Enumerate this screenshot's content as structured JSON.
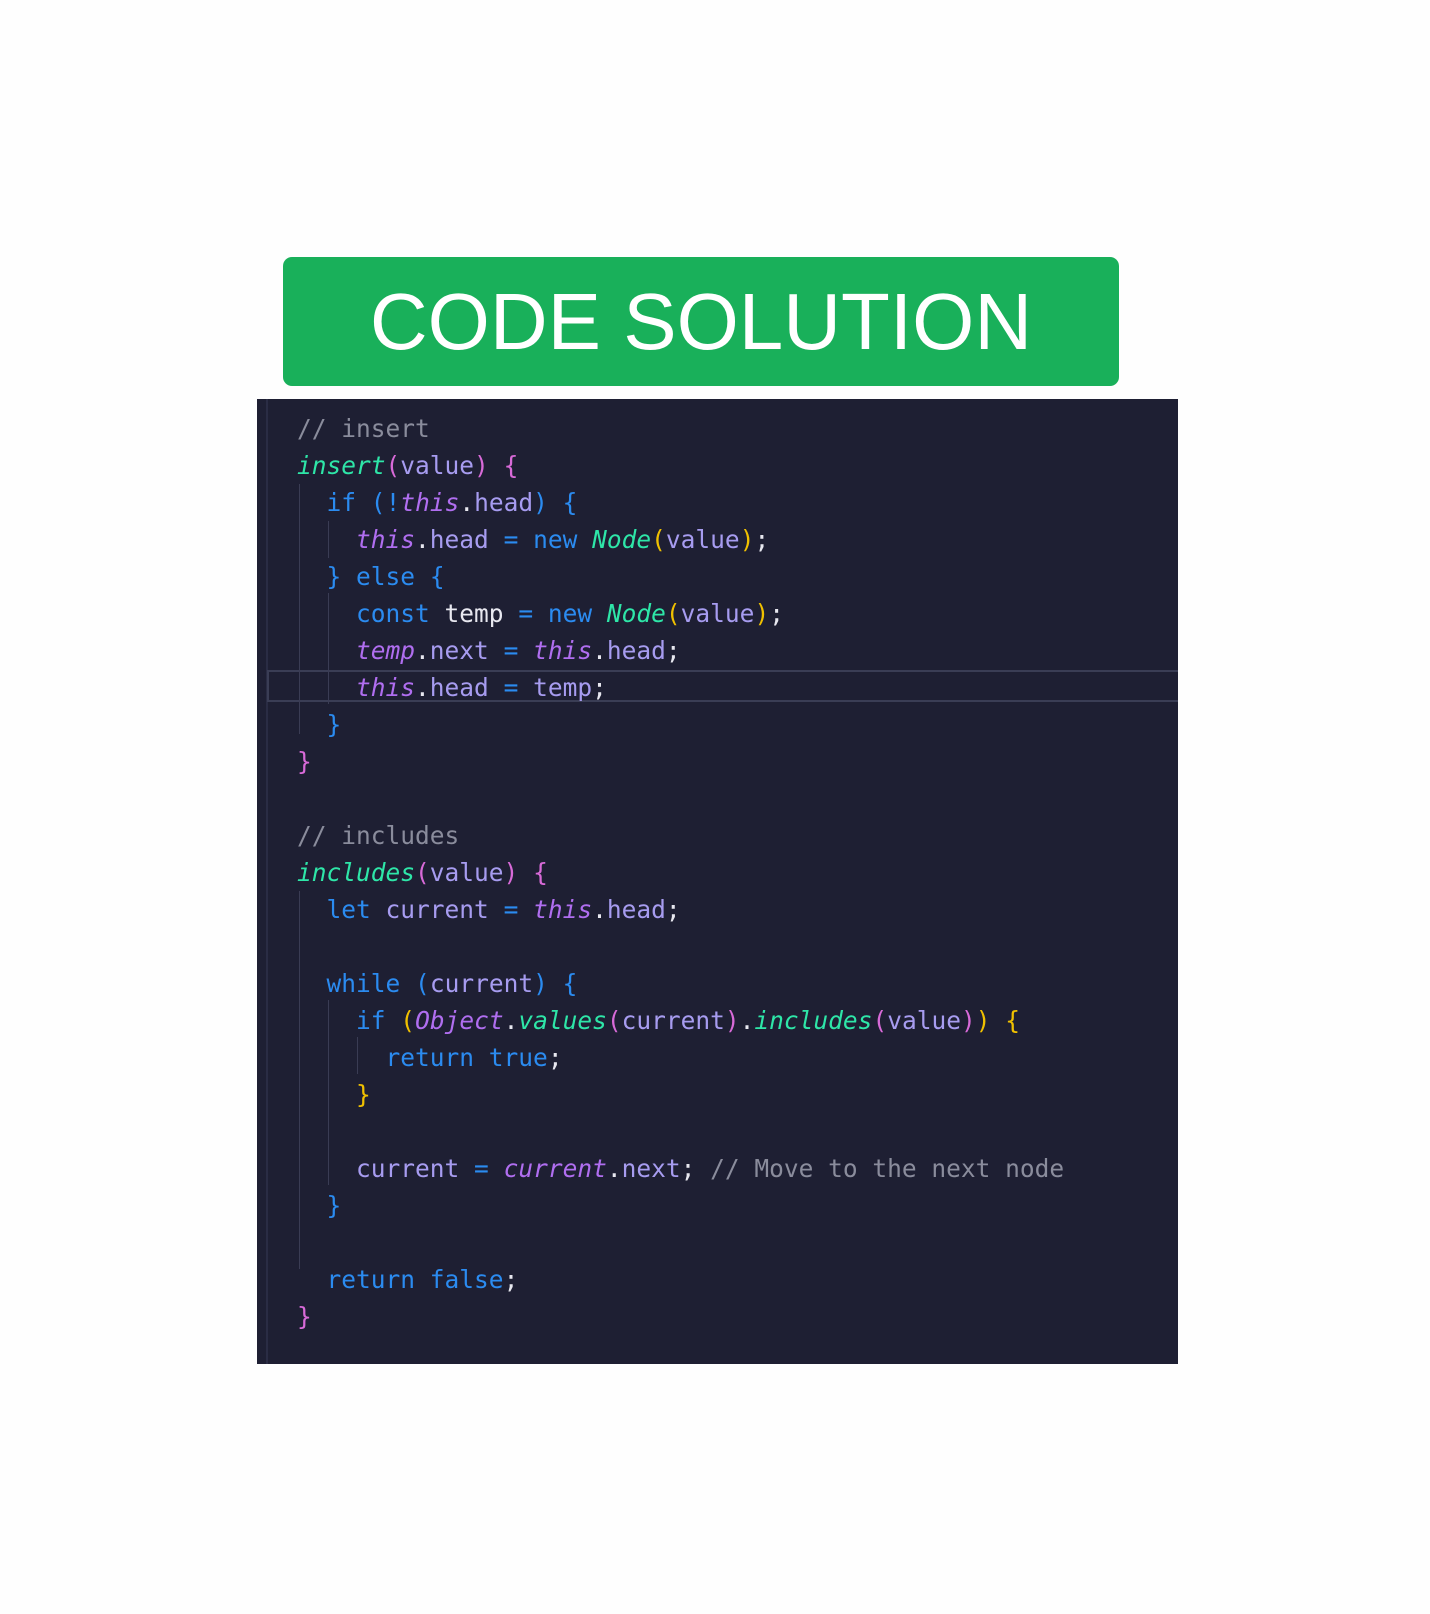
{
  "banner": {
    "title": "CODE SOLUTION",
    "color": "#19b05a"
  },
  "editor": {
    "background": "#1e1f33",
    "lines": [
      [
        {
          "t": "// insert",
          "c": "t-comment"
        }
      ],
      [
        {
          "t": "insert",
          "c": "t-fn"
        },
        {
          "t": "(",
          "c": "t-paren"
        },
        {
          "t": "value",
          "c": "t-param"
        },
        {
          "t": ")",
          "c": "t-paren"
        },
        {
          "t": " ",
          "c": "t-punct"
        },
        {
          "t": "{",
          "c": "t-paren"
        }
      ],
      [
        {
          "t": "  ",
          "c": "t-punct"
        },
        {
          "t": "if",
          "c": "t-kw"
        },
        {
          "t": " ",
          "c": "t-punct"
        },
        {
          "t": "(",
          "c": "t-paren2"
        },
        {
          "t": "!",
          "c": "t-op"
        },
        {
          "t": "this",
          "c": "t-this"
        },
        {
          "t": ".",
          "c": "t-punct"
        },
        {
          "t": "head",
          "c": "t-prop"
        },
        {
          "t": ")",
          "c": "t-paren2"
        },
        {
          "t": " ",
          "c": "t-punct"
        },
        {
          "t": "{",
          "c": "t-paren2"
        }
      ],
      [
        {
          "t": "    ",
          "c": "t-punct"
        },
        {
          "t": "this",
          "c": "t-this"
        },
        {
          "t": ".",
          "c": "t-punct"
        },
        {
          "t": "head",
          "c": "t-prop"
        },
        {
          "t": " ",
          "c": "t-punct"
        },
        {
          "t": "=",
          "c": "t-op"
        },
        {
          "t": " ",
          "c": "t-punct"
        },
        {
          "t": "new",
          "c": "t-kw"
        },
        {
          "t": " ",
          "c": "t-punct"
        },
        {
          "t": "Node",
          "c": "t-class"
        },
        {
          "t": "(",
          "c": "t-paren3"
        },
        {
          "t": "value",
          "c": "t-prop"
        },
        {
          "t": ")",
          "c": "t-paren3"
        },
        {
          "t": ";",
          "c": "t-punct"
        }
      ],
      [
        {
          "t": "  ",
          "c": "t-punct"
        },
        {
          "t": "}",
          "c": "t-paren2"
        },
        {
          "t": " ",
          "c": "t-punct"
        },
        {
          "t": "else",
          "c": "t-kw"
        },
        {
          "t": " ",
          "c": "t-punct"
        },
        {
          "t": "{",
          "c": "t-paren2"
        }
      ],
      [
        {
          "t": "    ",
          "c": "t-punct"
        },
        {
          "t": "const",
          "c": "t-kw"
        },
        {
          "t": " ",
          "c": "t-punct"
        },
        {
          "t": "temp",
          "c": "t-var"
        },
        {
          "t": " ",
          "c": "t-punct"
        },
        {
          "t": "=",
          "c": "t-op"
        },
        {
          "t": " ",
          "c": "t-punct"
        },
        {
          "t": "new",
          "c": "t-kw"
        },
        {
          "t": " ",
          "c": "t-punct"
        },
        {
          "t": "Node",
          "c": "t-class"
        },
        {
          "t": "(",
          "c": "t-paren3"
        },
        {
          "t": "value",
          "c": "t-prop"
        },
        {
          "t": ")",
          "c": "t-paren3"
        },
        {
          "t": ";",
          "c": "t-punct"
        }
      ],
      [
        {
          "t": "    ",
          "c": "t-punct"
        },
        {
          "t": "temp",
          "c": "t-this"
        },
        {
          "t": ".",
          "c": "t-punct"
        },
        {
          "t": "next",
          "c": "t-prop"
        },
        {
          "t": " ",
          "c": "t-punct"
        },
        {
          "t": "=",
          "c": "t-op"
        },
        {
          "t": " ",
          "c": "t-punct"
        },
        {
          "t": "this",
          "c": "t-this"
        },
        {
          "t": ".",
          "c": "t-punct"
        },
        {
          "t": "head",
          "c": "t-prop"
        },
        {
          "t": ";",
          "c": "t-punct"
        }
      ],
      [
        {
          "t": "    ",
          "c": "t-punct"
        },
        {
          "t": "this",
          "c": "t-this"
        },
        {
          "t": ".",
          "c": "t-punct"
        },
        {
          "t": "head",
          "c": "t-prop"
        },
        {
          "t": " ",
          "c": "t-punct"
        },
        {
          "t": "=",
          "c": "t-op"
        },
        {
          "t": " ",
          "c": "t-punct"
        },
        {
          "t": "temp",
          "c": "t-prop"
        },
        {
          "t": ";",
          "c": "t-punct"
        }
      ],
      [
        {
          "t": "  ",
          "c": "t-punct"
        },
        {
          "t": "}",
          "c": "t-paren2"
        }
      ],
      [
        {
          "t": "}",
          "c": "t-paren"
        }
      ],
      [],
      [
        {
          "t": "// includes",
          "c": "t-comment"
        }
      ],
      [
        {
          "t": "includes",
          "c": "t-fn"
        },
        {
          "t": "(",
          "c": "t-paren"
        },
        {
          "t": "value",
          "c": "t-param"
        },
        {
          "t": ")",
          "c": "t-paren"
        },
        {
          "t": " ",
          "c": "t-punct"
        },
        {
          "t": "{",
          "c": "t-paren"
        }
      ],
      [
        {
          "t": "  ",
          "c": "t-punct"
        },
        {
          "t": "let",
          "c": "t-kw"
        },
        {
          "t": " ",
          "c": "t-punct"
        },
        {
          "t": "current",
          "c": "t-prop"
        },
        {
          "t": " ",
          "c": "t-punct"
        },
        {
          "t": "=",
          "c": "t-op"
        },
        {
          "t": " ",
          "c": "t-punct"
        },
        {
          "t": "this",
          "c": "t-this"
        },
        {
          "t": ".",
          "c": "t-punct"
        },
        {
          "t": "head",
          "c": "t-prop"
        },
        {
          "t": ";",
          "c": "t-punct"
        }
      ],
      [],
      [
        {
          "t": "  ",
          "c": "t-punct"
        },
        {
          "t": "while",
          "c": "t-kw"
        },
        {
          "t": " ",
          "c": "t-punct"
        },
        {
          "t": "(",
          "c": "t-paren2"
        },
        {
          "t": "current",
          "c": "t-prop"
        },
        {
          "t": ")",
          "c": "t-paren2"
        },
        {
          "t": " ",
          "c": "t-punct"
        },
        {
          "t": "{",
          "c": "t-paren2"
        }
      ],
      [
        {
          "t": "    ",
          "c": "t-punct"
        },
        {
          "t": "if",
          "c": "t-kw"
        },
        {
          "t": " ",
          "c": "t-punct"
        },
        {
          "t": "(",
          "c": "t-paren3"
        },
        {
          "t": "Object",
          "c": "t-this"
        },
        {
          "t": ".",
          "c": "t-punct"
        },
        {
          "t": "values",
          "c": "t-method"
        },
        {
          "t": "(",
          "c": "t-paren"
        },
        {
          "t": "current",
          "c": "t-prop"
        },
        {
          "t": ")",
          "c": "t-paren"
        },
        {
          "t": ".",
          "c": "t-punct"
        },
        {
          "t": "includes",
          "c": "t-method"
        },
        {
          "t": "(",
          "c": "t-paren"
        },
        {
          "t": "value",
          "c": "t-prop"
        },
        {
          "t": ")",
          "c": "t-paren"
        },
        {
          "t": ")",
          "c": "t-paren3"
        },
        {
          "t": " ",
          "c": "t-punct"
        },
        {
          "t": "{",
          "c": "t-paren3"
        }
      ],
      [
        {
          "t": "      ",
          "c": "t-punct"
        },
        {
          "t": "return",
          "c": "t-kw"
        },
        {
          "t": " ",
          "c": "t-punct"
        },
        {
          "t": "true",
          "c": "t-bool"
        },
        {
          "t": ";",
          "c": "t-punct"
        }
      ],
      [
        {
          "t": "    ",
          "c": "t-punct"
        },
        {
          "t": "}",
          "c": "t-paren3"
        }
      ],
      [],
      [
        {
          "t": "    ",
          "c": "t-punct"
        },
        {
          "t": "current",
          "c": "t-prop"
        },
        {
          "t": " ",
          "c": "t-punct"
        },
        {
          "t": "=",
          "c": "t-op"
        },
        {
          "t": " ",
          "c": "t-punct"
        },
        {
          "t": "current",
          "c": "t-this"
        },
        {
          "t": ".",
          "c": "t-punct"
        },
        {
          "t": "next",
          "c": "t-prop"
        },
        {
          "t": ";",
          "c": "t-punct"
        },
        {
          "t": " ",
          "c": "t-punct"
        },
        {
          "t": "// Move to the next node",
          "c": "t-comment"
        }
      ],
      [
        {
          "t": "  ",
          "c": "t-punct"
        },
        {
          "t": "}",
          "c": "t-paren2"
        }
      ],
      [],
      [
        {
          "t": "  ",
          "c": "t-punct"
        },
        {
          "t": "return",
          "c": "t-kw"
        },
        {
          "t": " ",
          "c": "t-punct"
        },
        {
          "t": "false",
          "c": "t-bool"
        },
        {
          "t": ";",
          "c": "t-punct"
        }
      ],
      [
        {
          "t": "}",
          "c": "t-paren"
        }
      ]
    ]
  }
}
